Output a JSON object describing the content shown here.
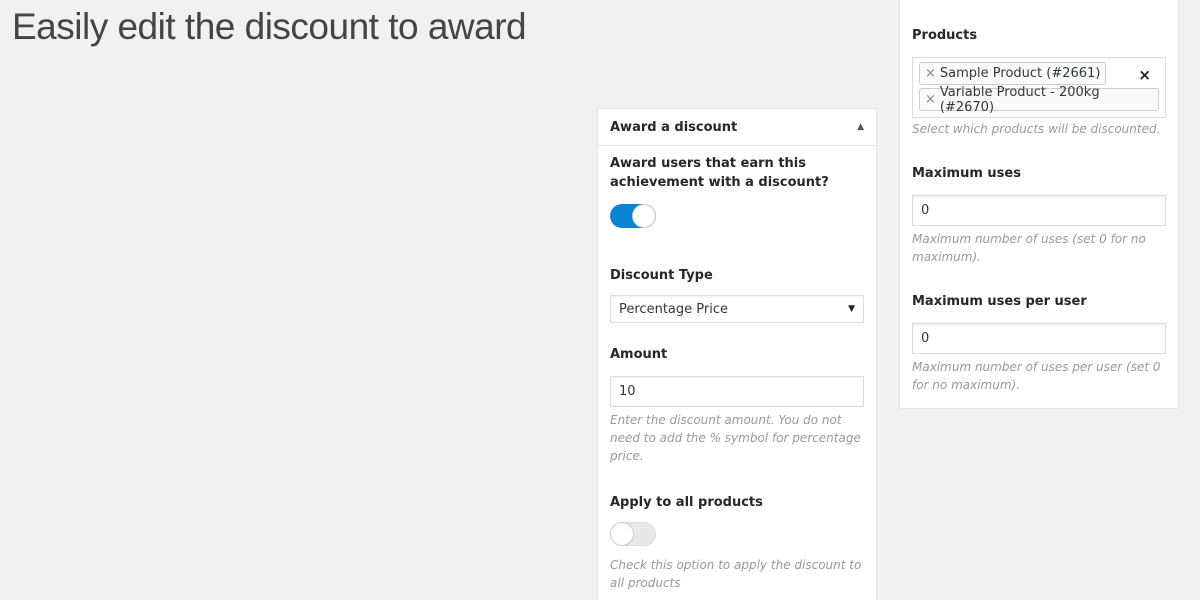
{
  "headline": "Easily edit the discount to award",
  "award_panel": {
    "title": "Award a discount",
    "award_question": "Award users that earn this achievement with a discount?",
    "award_toggle": "on",
    "discount_type_label": "Discount Type",
    "discount_type_value": "Percentage Price",
    "amount_label": "Amount",
    "amount_value": "10",
    "amount_desc": "Enter the discount amount. You do not need to add the % symbol for percentage price.",
    "apply_all_label": "Apply to all products",
    "apply_all_toggle": "off",
    "apply_all_desc": "Check this option to apply the discount to all products"
  },
  "products_panel": {
    "products_label": "Products",
    "products": [
      {
        "label": "Sample Product (#2661)"
      },
      {
        "label": "Variable Product - 200kg (#2670)"
      }
    ],
    "products_desc": "Select which products will be discounted.",
    "max_uses_label": "Maximum uses",
    "max_uses_value": "0",
    "max_uses_desc": "Maximum number of uses (set 0 for no maximum).",
    "max_uses_user_label": "Maximum uses per user",
    "max_uses_user_value": "0",
    "max_uses_user_desc": "Maximum number of uses per user (set 0 for no maximum)."
  },
  "colors": {
    "toggle_on": "#0a84d0",
    "page_bg": "#f1f1f1"
  },
  "icons": {
    "remove_tag": "×",
    "clear_all": "×",
    "caret_up": "▲",
    "select_arrow": "▼"
  }
}
